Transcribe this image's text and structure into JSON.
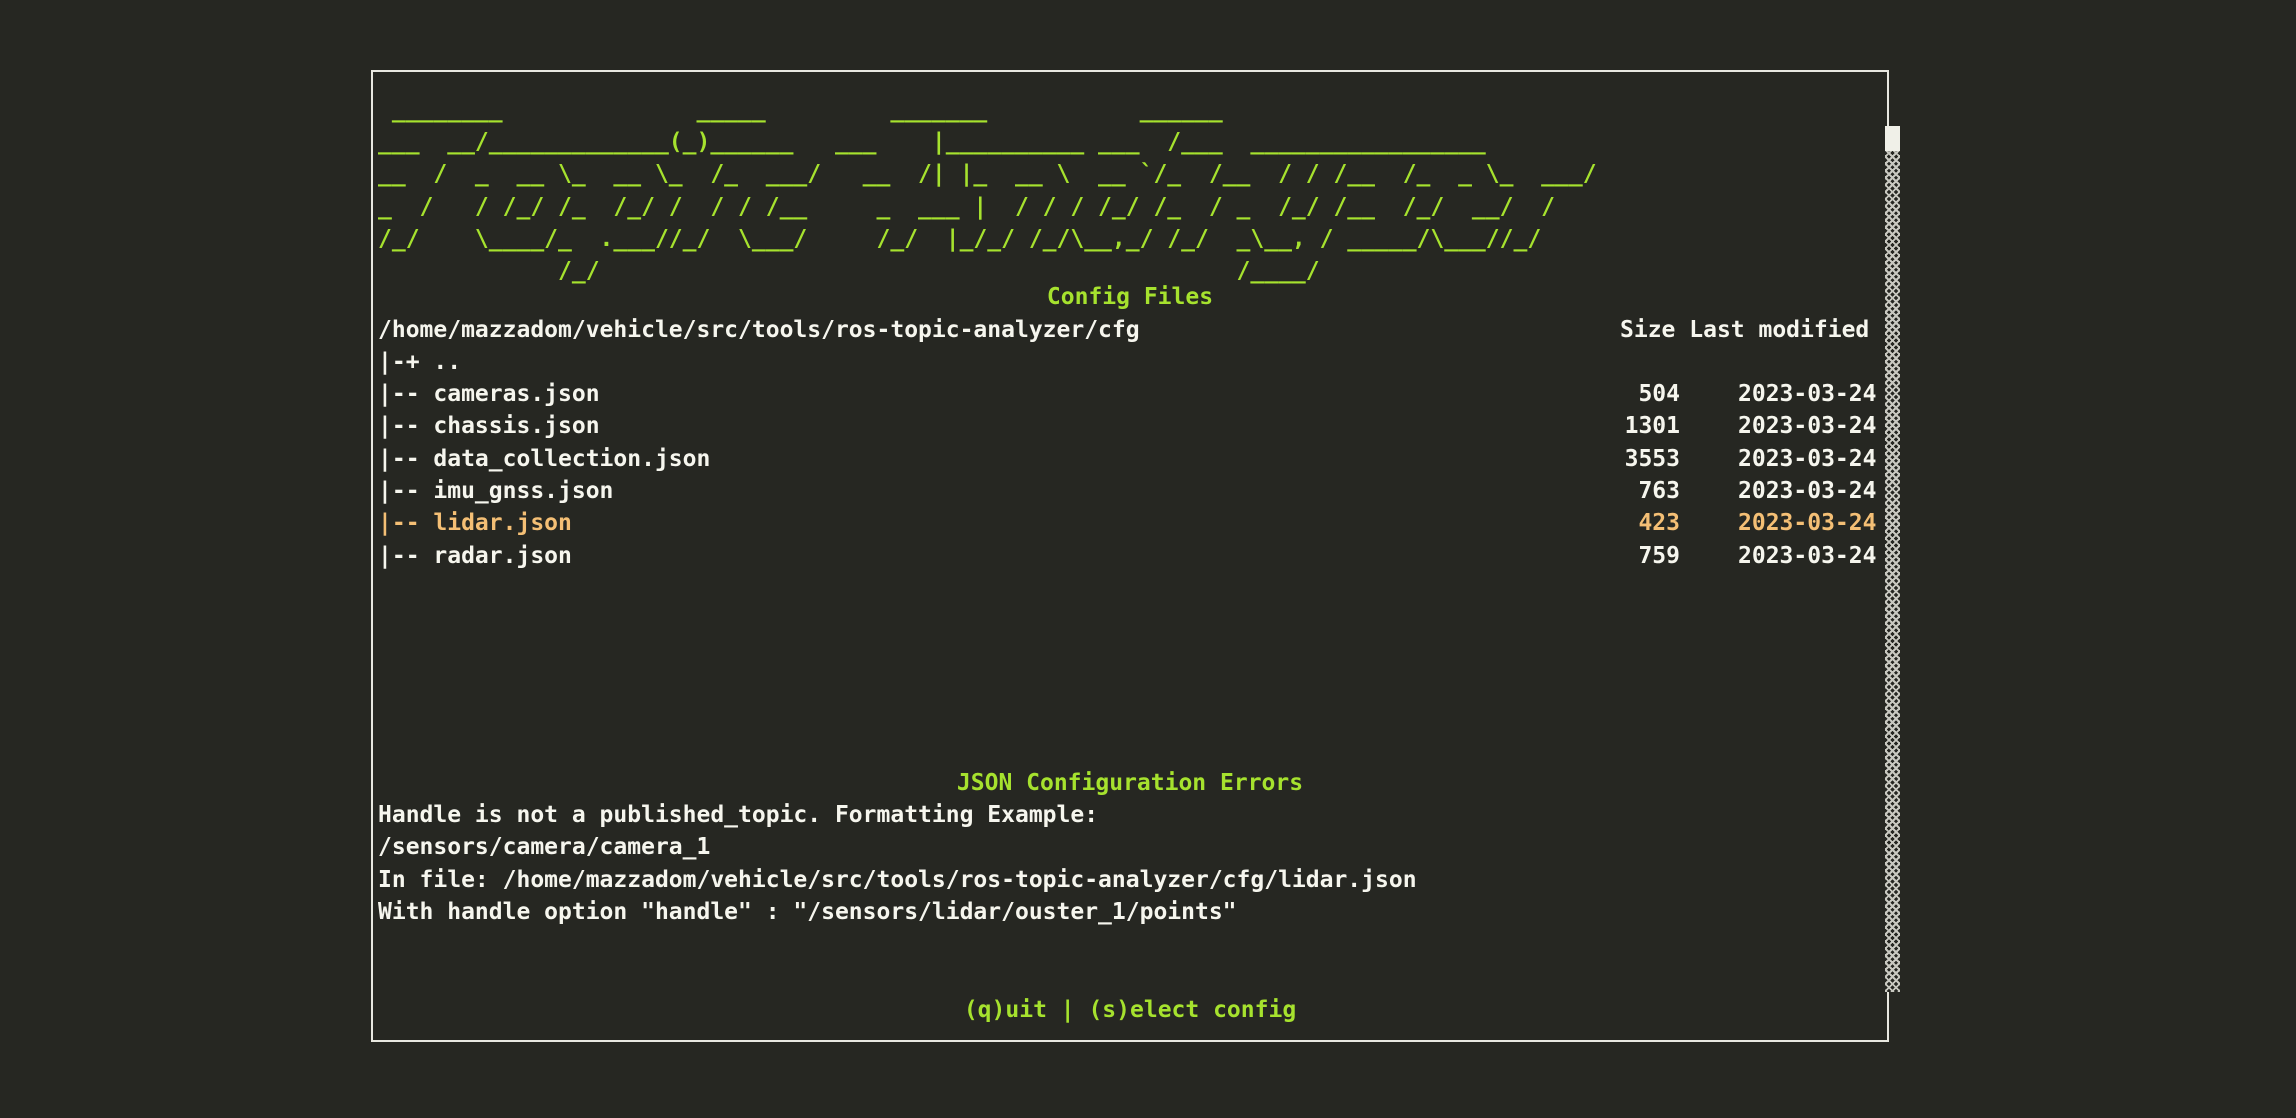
{
  "app": {
    "banner": " ________              _____         _______           ______\n___  __/_____________(_)______   ___    |__________ ___  /___  _________________\n__  /  _  __ \\_  __ \\_  /_  ___/   __  /| |_  __ \\  __ `/_  /__  / / /__  /_  _ \\_  ___/\n_  /   / /_/ /_  /_/ /  / / /__     _  ___ |  / / / /_/ /_  / _  /_/ /__  /_/  __/  /\n/_/    \\____/_  .___//_/  \\___/     /_/  |_/_/ /_/\\__,_/ /_/  _\\__, / _____/\\___//_/\n             /_/                                              /____/"
  },
  "file_browser": {
    "title": "Config Files",
    "path": "/home/mazzadom/vehicle/src/tools/ros-topic-analyzer/cfg",
    "col_size": "Size",
    "col_modified": "Last modified",
    "parent_entry": "|-+ ..",
    "files": [
      {
        "name": "|-- cameras.json",
        "size": "504",
        "modified": "2023-03-24"
      },
      {
        "name": "|-- chassis.json",
        "size": "1301",
        "modified": "2023-03-24"
      },
      {
        "name": "|-- data_collection.json",
        "size": "3553",
        "modified": "2023-03-24"
      },
      {
        "name": "|-- imu_gnss.json",
        "size": "763",
        "modified": "2023-03-24"
      },
      {
        "name": "|-- lidar.json",
        "size": "423",
        "modified": "2023-03-24"
      },
      {
        "name": "|-- radar.json",
        "size": "759",
        "modified": "2023-03-24"
      }
    ],
    "selected_index": 4
  },
  "errors": {
    "title": "JSON Configuration Errors",
    "lines": [
      "Handle is not a published_topic. Formatting Example:",
      "/sensors/camera/camera_1",
      "In file: /home/mazzadom/vehicle/src/tools/ros-topic-analyzer/cfg/lidar.json",
      "With handle option \"handle\" : \"/sensors/lidar/ouster_1/points\""
    ]
  },
  "footer": {
    "keys": "(q)uit | (s)elect config"
  },
  "colors": {
    "background": "#262722",
    "accent_green": "#a6e22e",
    "selected_orange": "#f4bf75",
    "text": "#f6f6ee"
  }
}
